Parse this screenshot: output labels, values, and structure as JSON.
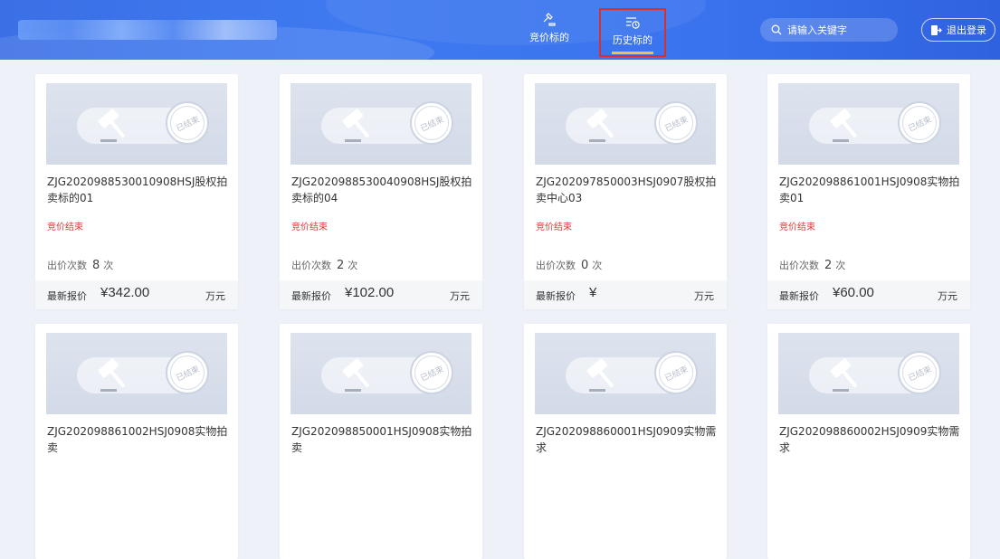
{
  "nav": {
    "items": [
      {
        "label": "竞价标的",
        "icon": "gavel-nav-icon",
        "active": false
      },
      {
        "label": "历史标的",
        "icon": "history-icon",
        "active": true
      }
    ]
  },
  "search": {
    "placeholder": "请输入关键字",
    "icon": "search-icon"
  },
  "logout": {
    "label": "退出登录",
    "icon": "logout-icon"
  },
  "cards": [
    {
      "title": "ZJG2020988530010908HSJ股权拍卖标的01",
      "status": "竞价结束",
      "stamp": "已结束",
      "bids_label": "出价次数",
      "bids_count": "8",
      "bids_unit": "次",
      "price_label": "最新报价",
      "price": "¥342.00",
      "price_unit": "万元"
    },
    {
      "title": "ZJG2020988530040908HSJ股权拍卖标的04",
      "status": "竞价结束",
      "stamp": "已结束",
      "bids_label": "出价次数",
      "bids_count": "2",
      "bids_unit": "次",
      "price_label": "最新报价",
      "price": "¥102.00",
      "price_unit": "万元"
    },
    {
      "title": "ZJG202097850003HSJ0907股权拍卖中心03",
      "status": "竞价结束",
      "stamp": "已结束",
      "bids_label": "出价次数",
      "bids_count": "0",
      "bids_unit": "次",
      "price_label": "最新报价",
      "price": "¥",
      "price_unit": "万元"
    },
    {
      "title": "ZJG202098861001HSJ0908实物拍卖01",
      "status": "竞价结束",
      "stamp": "已结束",
      "bids_label": "出价次数",
      "bids_count": "2",
      "bids_unit": "次",
      "price_label": "最新报价",
      "price": "¥60.00",
      "price_unit": "万元"
    },
    {
      "title": "ZJG202098861002HSJ0908实物拍卖",
      "stamp": "已结束"
    },
    {
      "title": "ZJG202098850001HSJ0908实物拍卖",
      "stamp": "已结束"
    },
    {
      "title": "ZJG202098860001HSJ0909实物需求",
      "stamp": "已结束"
    },
    {
      "title": "ZJG202098860002HSJ0909实物需求",
      "stamp": "已结束"
    }
  ],
  "colors": {
    "header": "#3a73ee",
    "status": "#e23a3a",
    "active_underline": "#f5c43a",
    "highlight_border": "#d63030"
  }
}
